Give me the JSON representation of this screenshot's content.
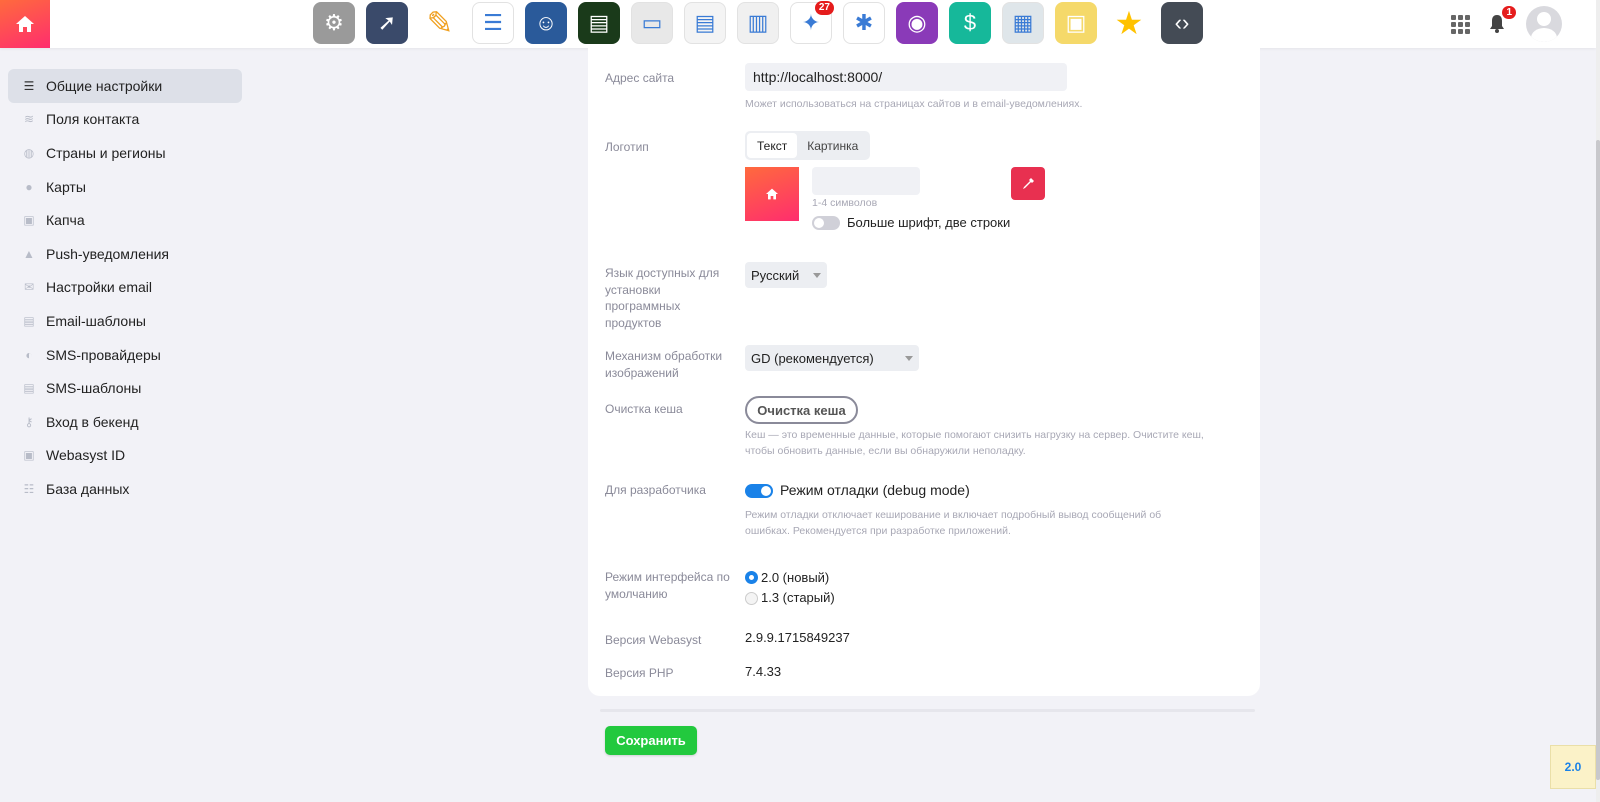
{
  "topbar": {
    "apps": [
      {
        "name": "settings-app-icon",
        "color": "#9a9a9a",
        "badge": ""
      },
      {
        "name": "compass-app-icon",
        "color": "#3a4a6a",
        "badge": ""
      },
      {
        "name": "pencil-app-icon",
        "color": "#f0a020",
        "badge": ""
      },
      {
        "name": "checklist-app-icon",
        "color": "#ffffff",
        "badge": ""
      },
      {
        "name": "contacts-app-icon",
        "color": "#2a5a9a",
        "badge": ""
      },
      {
        "name": "terminal-app-icon",
        "color": "#1a3a1a",
        "badge": ""
      },
      {
        "name": "window-app-icon",
        "color": "#e8e8e8",
        "badge": ""
      },
      {
        "name": "document-app-icon",
        "color": "#f4f4f4",
        "badge": ""
      },
      {
        "name": "doc-sticker-app-icon",
        "color": "#f0f0f0",
        "badge": ""
      },
      {
        "name": "sparkle-app-icon",
        "color": "#ffffff",
        "badge": "27"
      },
      {
        "name": "asterisk-app-icon",
        "color": "#ffffff",
        "badge": ""
      },
      {
        "name": "photo-app-icon",
        "color": "#8a3ab8",
        "badge": ""
      },
      {
        "name": "dollar-app-icon",
        "color": "#16b89a",
        "badge": ""
      },
      {
        "name": "layout-app-icon",
        "color": "#dfe6ea",
        "badge": ""
      },
      {
        "name": "stickies-app-icon",
        "color": "#f5d96a",
        "badge": ""
      },
      {
        "name": "star-app-icon",
        "color": "#ffc200",
        "badge": ""
      },
      {
        "name": "code-app-icon",
        "color": "#444b55",
        "badge": ""
      }
    ],
    "notifications_count": "1"
  },
  "sidebar": {
    "items": [
      {
        "label": "Общие настройки",
        "icon": "sliders-icon"
      },
      {
        "label": "Поля контакта",
        "icon": "layers-icon"
      },
      {
        "label": "Страны и регионы",
        "icon": "globe-icon"
      },
      {
        "label": "Карты",
        "icon": "map-pin-icon"
      },
      {
        "label": "Капча",
        "icon": "lock-icon"
      },
      {
        "label": "Push-уведомления",
        "icon": "bell-icon"
      },
      {
        "label": "Настройки email",
        "icon": "envelope-icon"
      },
      {
        "label": "Email-шаблоны",
        "icon": "file-icon"
      },
      {
        "label": "SMS-провайдеры",
        "icon": "chat-icon"
      },
      {
        "label": "SMS-шаблоны",
        "icon": "file-icon"
      },
      {
        "label": "Вход в бекенд",
        "icon": "key-icon"
      },
      {
        "label": "Webasyst ID",
        "icon": "lock-icon"
      },
      {
        "label": "База данных",
        "icon": "database-icon"
      }
    ]
  },
  "settings": {
    "site_address": {
      "label": "Адрес сайта",
      "value": "http://localhost:8000/",
      "hint": "Может использоваться на страницах сайтов и в email-уведомлениях."
    },
    "logo": {
      "label": "Логотип",
      "tab_text": "Текст",
      "tab_image": "Картинка",
      "text_hint": "1-4 символов",
      "toggle_label": "Больше шрифт, две строки"
    },
    "language": {
      "label": "Язык доступных для установки программных продуктов",
      "value": "Русский"
    },
    "image_engine": {
      "label": "Механизм обработки изображений",
      "value": "GD (рекомендуется)"
    },
    "cache": {
      "label": "Очистка кеша",
      "button": "Очистка кеша",
      "hint": "Кеш — это временные данные, которые помогают снизить нагрузку на сервер. Очистите кеш, чтобы обновить данные, если вы обнаружили неполадку."
    },
    "developer": {
      "label": "Для разработчика",
      "toggle_label": "Режим отладки (debug mode)",
      "hint": "Режим отладки отключает кеширование и включает подробный вывод сообщений об ошибках. Рекомендуется при разработке приложений."
    },
    "ui_mode": {
      "label": "Режим интерфейса по умолчанию",
      "option_new": "2.0 (новый)",
      "option_old": "1.3 (старый)"
    },
    "webasyst_version": {
      "label": "Версия Webasyst",
      "value": "2.9.9.1715849237"
    },
    "php_version": {
      "label": "Версия PHP",
      "value": "7.4.33"
    }
  },
  "footer": {
    "save_button": "Сохранить",
    "corner_badge": "2.0"
  },
  "colors": {
    "accent": "#1a82e8",
    "save": "#22c93e",
    "brand_gradient_start": "#ff6a3d",
    "brand_gradient_end": "#ff2d6e"
  }
}
